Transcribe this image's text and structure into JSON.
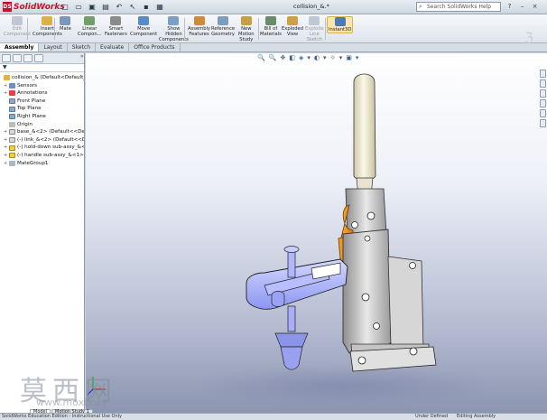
{
  "app": {
    "name": "SolidWorks",
    "document_title": "collision_&.*"
  },
  "quick_access": [
    {
      "icon": "new-icon",
      "glyph": "□"
    },
    {
      "icon": "open-icon",
      "glyph": "▭"
    },
    {
      "icon": "save-icon",
      "glyph": "▣"
    },
    {
      "icon": "print-icon",
      "glyph": "▤"
    },
    {
      "icon": "undo-icon",
      "glyph": "↶"
    },
    {
      "icon": "select-icon",
      "glyph": "↖"
    },
    {
      "icon": "rebuild-icon",
      "glyph": "▪"
    },
    {
      "icon": "options-icon",
      "glyph": "▦"
    }
  ],
  "search": {
    "placeholder": "Search SolidWorks Help"
  },
  "window_buttons": {
    "help": "?",
    "minimize": "–",
    "close": "×"
  },
  "ribbon": [
    {
      "label1": "Edit",
      "label2": "Component",
      "state": "disabled",
      "color": "#c0c8d2"
    },
    {
      "label1": "Insert",
      "label2": "Components",
      "state": "normal",
      "color": "#e0b040"
    },
    {
      "label1": "Mate",
      "label2": "",
      "state": "normal",
      "color": "#7a96b8"
    },
    {
      "label1": "Linear",
      "label2": "Compon...",
      "state": "normal",
      "color": "#6fa06a"
    },
    {
      "label1": "Smart",
      "label2": "Fasteners",
      "state": "normal",
      "color": "#8a8a8a"
    },
    {
      "label1": "Move",
      "label2": "Component",
      "state": "normal",
      "color": "#5a8ac8"
    },
    {
      "label1": "Show",
      "label2": "Hidden",
      "label3": "Components",
      "state": "normal",
      "color": "#7aa0c8"
    },
    {
      "label1": "Assembly",
      "label2": "Features",
      "state": "normal",
      "color": "#d08a3a"
    },
    {
      "label1": "Reference",
      "label2": "Geometry",
      "state": "normal",
      "color": "#7d9cc0"
    },
    {
      "label1": "New",
      "label2": "Motion",
      "label3": "Study",
      "state": "normal",
      "color": "#c8a040"
    },
    {
      "label1": "Bill of",
      "label2": "Materials",
      "state": "normal",
      "color": "#6a8a6a"
    },
    {
      "label1": "Exploded",
      "label2": "View",
      "state": "normal",
      "color": "#d0a040"
    },
    {
      "label1": "Explode",
      "label2": "Line",
      "label3": "Sketch",
      "state": "disabled",
      "color": "#c0c8d2"
    },
    {
      "label1": "Instant3D",
      "label2": "",
      "state": "active",
      "color": "#4a7ab8"
    }
  ],
  "tabs": [
    "Assembly",
    "Layout",
    "Sketch",
    "Evaluate",
    "Office Products"
  ],
  "active_tab": "Assembly",
  "tree": {
    "root": "collision_& (Default<Default_Di",
    "items": [
      {
        "label": "Sensors",
        "icon": "sensor-icon"
      },
      {
        "label": "Annotations",
        "icon": "annotations-icon"
      },
      {
        "label": "Front Plane",
        "icon": "plane-icon"
      },
      {
        "label": "Top Plane",
        "icon": "plane-icon"
      },
      {
        "label": "Right Plane",
        "icon": "plane-icon"
      },
      {
        "label": "Origin",
        "icon": "origin-icon"
      },
      {
        "label": "base_&<2> (Default<<Defau",
        "icon": "part-icon"
      },
      {
        "label": "(-) link_&<2> (Default<<Def",
        "icon": "part-icon"
      },
      {
        "label": "(-) hold-down sub-assy_&<2",
        "icon": "subassembly-icon"
      },
      {
        "label": "(-) handle sub-assy_&<1> (D",
        "icon": "subassembly-icon"
      },
      {
        "label": "MateGroup1",
        "icon": "mategroup-icon"
      }
    ]
  },
  "heads_up_toolbar": [
    "🔍",
    "🔍",
    "✥",
    "◧",
    "◈",
    "▾",
    "◐",
    "▾",
    "☼",
    "▾",
    "▣",
    "▾"
  ],
  "status": {
    "left": "SolidWorks Education Edition - Instructional Use Only",
    "state": "Under Defined",
    "mode": "Editing Assembly"
  },
  "bottom_tabs": [
    "Model",
    "Motion Study 1"
  ],
  "watermark": {
    "chars": "莫西网",
    "url": "www.moxi.net"
  },
  "colors": {
    "orange_link": "#f09a1e",
    "blue_holddown": "#aab4ff",
    "handle_white": "#f4f0dc",
    "steel": "#c8c8c8"
  }
}
